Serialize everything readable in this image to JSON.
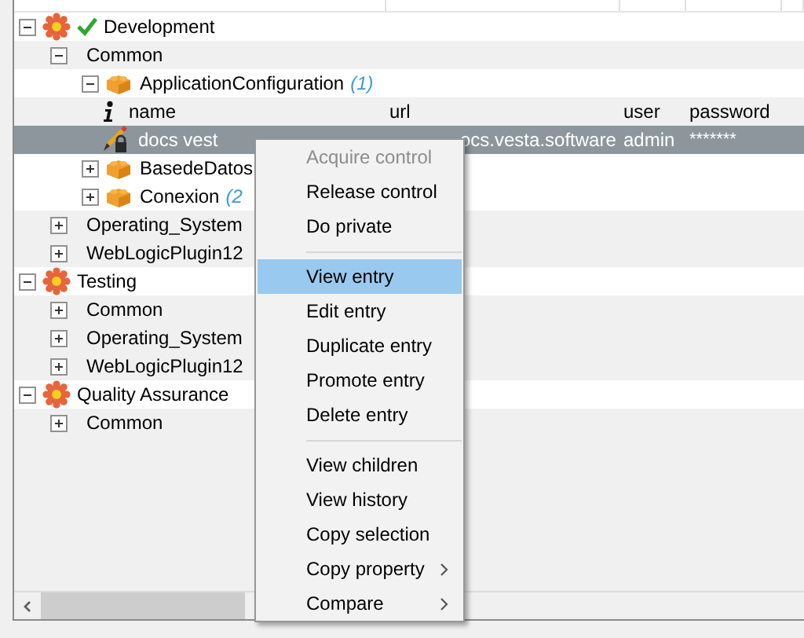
{
  "tree": [
    {
      "label": "Development",
      "kind": "environment",
      "expanded": true,
      "verified": true,
      "children": [
        {
          "label": "Common",
          "kind": "folder",
          "expanded": true,
          "children": [
            {
              "label": "ApplicationConfiguration",
              "count": "(1)",
              "kind": "component",
              "expanded": true,
              "children": [
                {
                  "kind": "header",
                  "cells": [
                    "name",
                    "url",
                    "user",
                    "password"
                  ]
                },
                {
                  "kind": "entry",
                  "selected": true,
                  "cells": [
                    "docs vest",
                    "ocs.vesta.software",
                    "admin",
                    "*******"
                  ]
                }
              ]
            },
            {
              "label": "BasedeDatos",
              "kind": "component",
              "expanded": false
            },
            {
              "label": "Conexion",
              "count": "(2",
              "kind": "component",
              "expanded": false
            }
          ]
        },
        {
          "label": "Operating_System",
          "kind": "folder",
          "expanded": false
        },
        {
          "label": "WebLogicPlugin12",
          "kind": "folder",
          "expanded": false
        }
      ]
    },
    {
      "label": "Testing",
      "kind": "environment",
      "expanded": true,
      "verified": false,
      "children": [
        {
          "label": "Common",
          "kind": "folder",
          "expanded": false
        },
        {
          "label": "Operating_System",
          "kind": "folder",
          "expanded": false
        },
        {
          "label": "WebLogicPlugin12",
          "kind": "folder",
          "expanded": false
        }
      ]
    },
    {
      "label": "Quality Assurance",
      "kind": "environment",
      "expanded": true,
      "verified": false,
      "children": [
        {
          "label": "Common",
          "kind": "folder",
          "expanded": false
        }
      ]
    }
  ],
  "context_menu": [
    {
      "kind": "item",
      "label": "Acquire control",
      "disabled": true,
      "highlighted": false
    },
    {
      "kind": "item",
      "label": "Release control",
      "disabled": false,
      "highlighted": false
    },
    {
      "kind": "item",
      "label": "Do private",
      "disabled": false,
      "highlighted": false
    },
    {
      "kind": "separator"
    },
    {
      "kind": "item",
      "label": "View entry",
      "disabled": false,
      "highlighted": true
    },
    {
      "kind": "item",
      "label": "Edit entry",
      "disabled": false,
      "highlighted": false
    },
    {
      "kind": "item",
      "label": "Duplicate entry",
      "disabled": false,
      "highlighted": false
    },
    {
      "kind": "item",
      "label": "Promote entry",
      "disabled": false,
      "highlighted": false
    },
    {
      "kind": "item",
      "label": "Delete entry",
      "disabled": false,
      "highlighted": false
    },
    {
      "kind": "separator"
    },
    {
      "kind": "item",
      "label": "View children",
      "disabled": false,
      "highlighted": false
    },
    {
      "kind": "item",
      "label": "View history",
      "disabled": false,
      "highlighted": false
    },
    {
      "kind": "item",
      "label": "Copy selection",
      "disabled": false,
      "highlighted": false
    },
    {
      "kind": "item",
      "label": "Copy property",
      "disabled": false,
      "highlighted": false,
      "submenu": true
    },
    {
      "kind": "item",
      "label": "Compare",
      "disabled": false,
      "highlighted": false,
      "submenu": true
    }
  ]
}
